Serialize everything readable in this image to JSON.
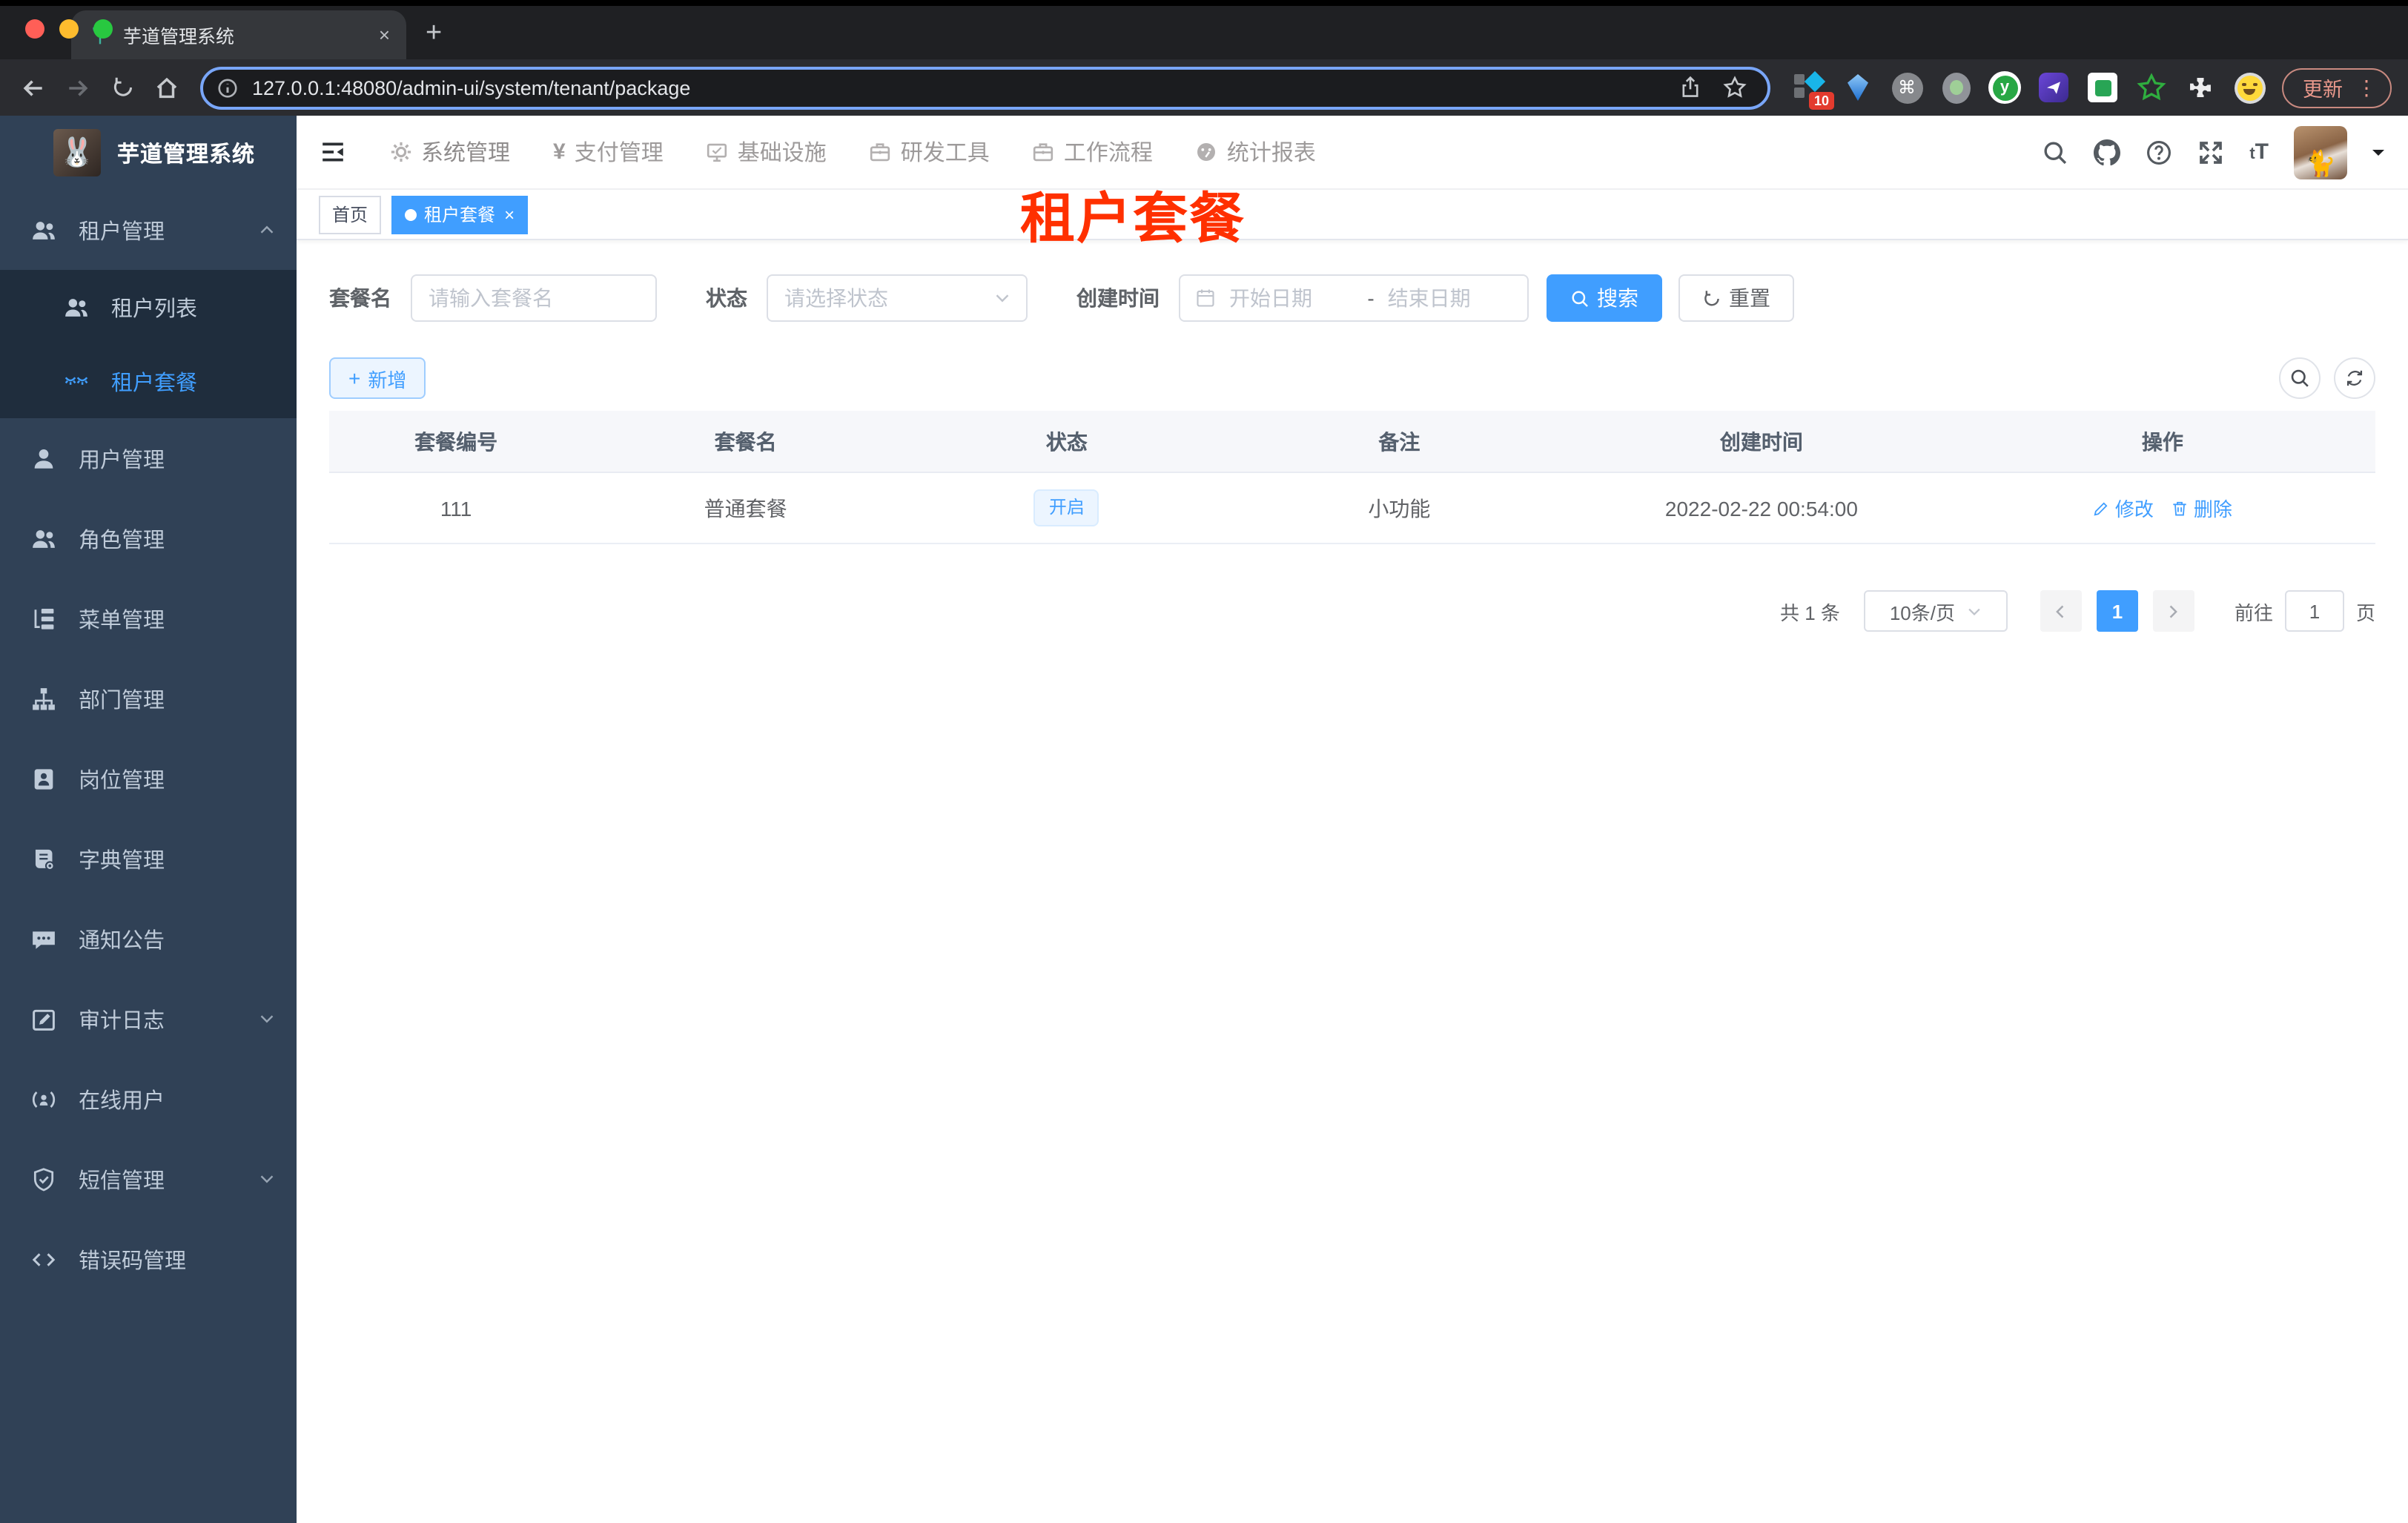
{
  "browser": {
    "tab_title": "芋道管理系统",
    "new_tab_glyph": "+",
    "close_tab_glyph": "×",
    "url": "127.0.0.1:48080/admin-ui/system/tenant/package",
    "ext_badge": "10",
    "cmd_glyph": "⌘",
    "ext_y_glyph": "y",
    "star_glyph": "☆",
    "update_label": "更新",
    "menu_dots": "⋮"
  },
  "colors": {
    "accent": "#409eff",
    "sidebar_bg": "#304156",
    "submenu_bg": "#1f2d3d",
    "sidebar_text": "#bfcbd9",
    "overlay_title_red": "#ff3000",
    "status_tag_bg": "#ecf5ff",
    "status_tag_border": "#d9ecff",
    "urlbar_focus_ring": "#79a6f8"
  },
  "top_nav": {
    "items": [
      {
        "label": "系统管理"
      },
      {
        "label": "支付管理"
      },
      {
        "label": "基础设施"
      },
      {
        "label": "研发工具"
      },
      {
        "label": "工作流程"
      },
      {
        "label": "统计报表"
      }
    ],
    "yen_glyph": "¥",
    "text_size_glyph_small": "t",
    "text_size_glyph_big": "T"
  },
  "sidebar": {
    "title": "芋道管理系统",
    "items": [
      {
        "label": "租户管理"
      },
      {
        "label": "租户列表"
      },
      {
        "label": "租户套餐"
      },
      {
        "label": "用户管理"
      },
      {
        "label": "角色管理"
      },
      {
        "label": "菜单管理"
      },
      {
        "label": "部门管理"
      },
      {
        "label": "岗位管理"
      },
      {
        "label": "字典管理"
      },
      {
        "label": "通知公告"
      },
      {
        "label": "审计日志"
      },
      {
        "label": "在线用户"
      },
      {
        "label": "短信管理"
      },
      {
        "label": "错误码管理"
      }
    ]
  },
  "tags": {
    "home": "首页",
    "active": "租户套餐",
    "close_glyph": "×"
  },
  "overlay_title": "租户套餐",
  "filters": {
    "name_label": "套餐名",
    "name_placeholder": "请输入套餐名",
    "status_label": "状态",
    "status_placeholder": "请选择状态",
    "date_label": "创建时间",
    "date_start": "开始日期",
    "date_separator": "-",
    "date_end": "结束日期",
    "search_label": "搜索",
    "reset_label": "重置"
  },
  "toolbar": {
    "add_label": "新增"
  },
  "table": {
    "columns": [
      "套餐编号",
      "套餐名",
      "状态",
      "备注",
      "创建时间",
      "操作"
    ],
    "row": {
      "id": "111",
      "name": "普通套餐",
      "status": "开启",
      "remark": "小功能",
      "created_at": "2022-02-22 00:54:00",
      "edit_label": "修改",
      "delete_label": "删除"
    }
  },
  "pagination": {
    "total": "共 1 条",
    "page_size": "10条/页",
    "current": "1",
    "goto_label": "前往",
    "goto_value": "1",
    "unit": "页"
  }
}
